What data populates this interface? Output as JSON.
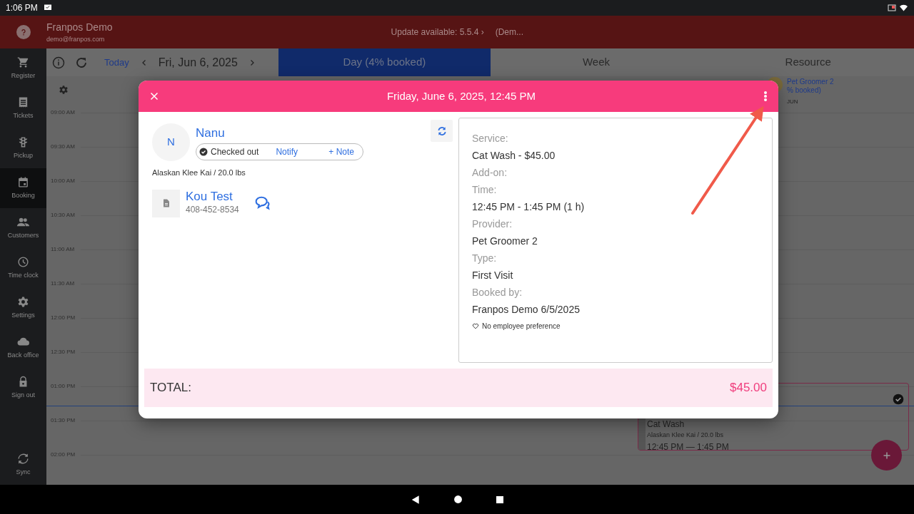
{
  "status_bar": {
    "time": "1:06 PM"
  },
  "header": {
    "title": "Franpos Demo",
    "email": "demo@franpos.com",
    "update_notice": "Update available: 5.5.4 ›",
    "mode_notice": "(Dem..."
  },
  "sidebar": {
    "items": [
      {
        "label": "Register",
        "selected": false
      },
      {
        "label": "Tickets",
        "selected": false
      },
      {
        "label": "Pickup",
        "selected": false
      },
      {
        "label": "Booking",
        "selected": true
      },
      {
        "label": "Customers",
        "selected": false
      },
      {
        "label": "Time clock",
        "selected": false
      },
      {
        "label": "Settings",
        "selected": false
      },
      {
        "label": "Back office",
        "selected": false
      },
      {
        "label": "Sign out",
        "selected": false
      }
    ],
    "sync": "Sync"
  },
  "toolbar": {
    "today": "Today",
    "date": "Fri, Jun 6, 2025"
  },
  "tabs": [
    {
      "label": "Day (4% booked)",
      "selected": true
    },
    {
      "label": "Week",
      "selected": false
    },
    {
      "label": "Resource",
      "selected": false
    }
  ],
  "calendar": {
    "resource_name": "Pet Groomer 2",
    "resource_booked": "% booked)",
    "month": "JUN",
    "time_slots": [
      "09:00 AM",
      "09:30 AM",
      "10:00 AM",
      "10:30 AM",
      "11:00 AM",
      "11:30 AM",
      "12:00 PM",
      "12:30 PM",
      "01:00 PM",
      "01:30 PM",
      "02:00 PM"
    ],
    "event": {
      "service": "Cat Wash",
      "pet": "Alaskan Klee Kai / 20.0 lbs",
      "time": "12:45 PM — 1:45 PM",
      "checked_out": true
    }
  },
  "modal": {
    "title": "Friday, June 6, 2025, 12:45 PM",
    "pet": {
      "initial": "N",
      "name": "Nanu",
      "status": "Checked out",
      "notify": "Notify",
      "note": "+ Note",
      "breed": "Alaskan Klee Kai / 20.0 lbs"
    },
    "owner": {
      "name": "Kou Test",
      "phone": "408-452-8534"
    },
    "details": [
      {
        "label": "Service:",
        "value": "Cat Wash - $45.00"
      },
      {
        "label": "Add-on:"
      },
      {
        "label": "Time:",
        "value": "12:45 PM - 1:45 PM (1 h)"
      },
      {
        "label": "Provider:",
        "value": "Pet Groomer 2"
      },
      {
        "label": "Type:",
        "value": "First Visit"
      },
      {
        "label": "Booked by:",
        "value": "Franpos Demo 6/5/2025"
      }
    ],
    "preference": "No employee preference",
    "total_label": "TOTAL:",
    "total_value": "$45.00"
  }
}
